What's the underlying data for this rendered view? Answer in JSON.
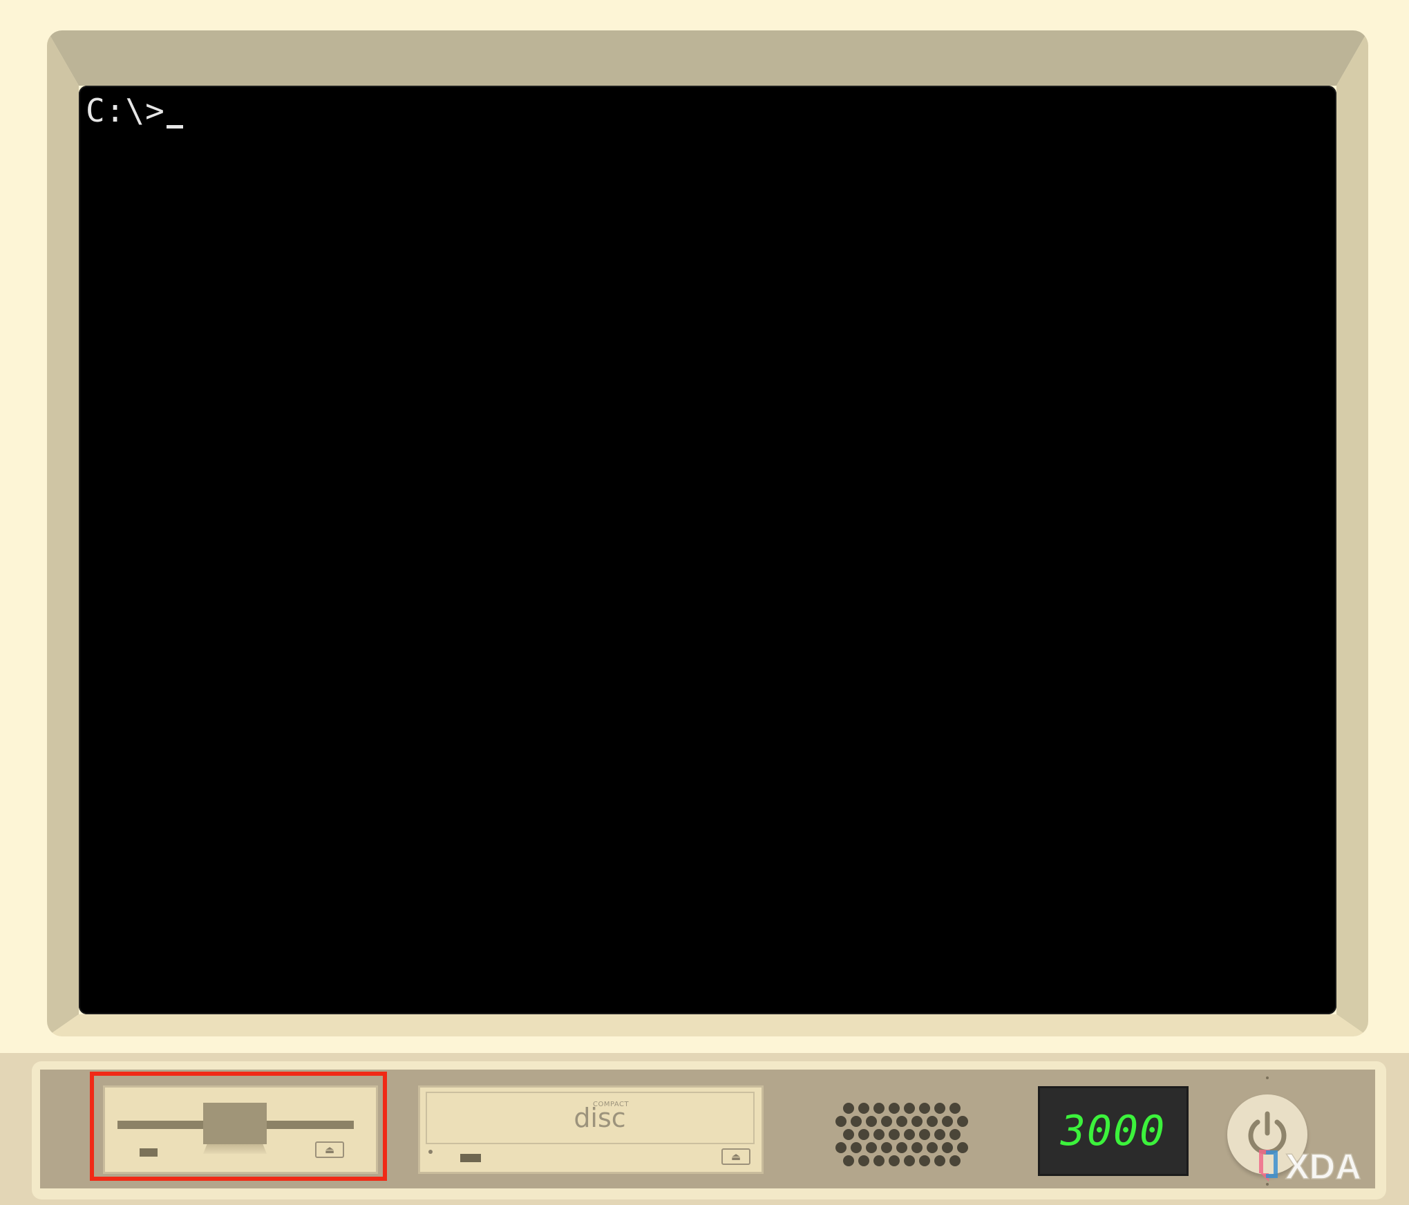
{
  "screen": {
    "prompt": "C:\\>"
  },
  "cdrom": {
    "logo_small": "COMPACT",
    "logo_big": "disc",
    "eject_symbol": "⏏"
  },
  "floppy": {
    "eject_symbol": "⏏"
  },
  "display": {
    "value": "3000",
    "color": "#3cf23c"
  },
  "watermark": {
    "text": "XDA"
  },
  "colors": {
    "background": "#fdf5d6",
    "bezel": "#bcb497",
    "screen": "#000000",
    "highlight": "#f02a16"
  },
  "icons": {
    "power": "power-icon",
    "speaker": "speaker-grille"
  }
}
